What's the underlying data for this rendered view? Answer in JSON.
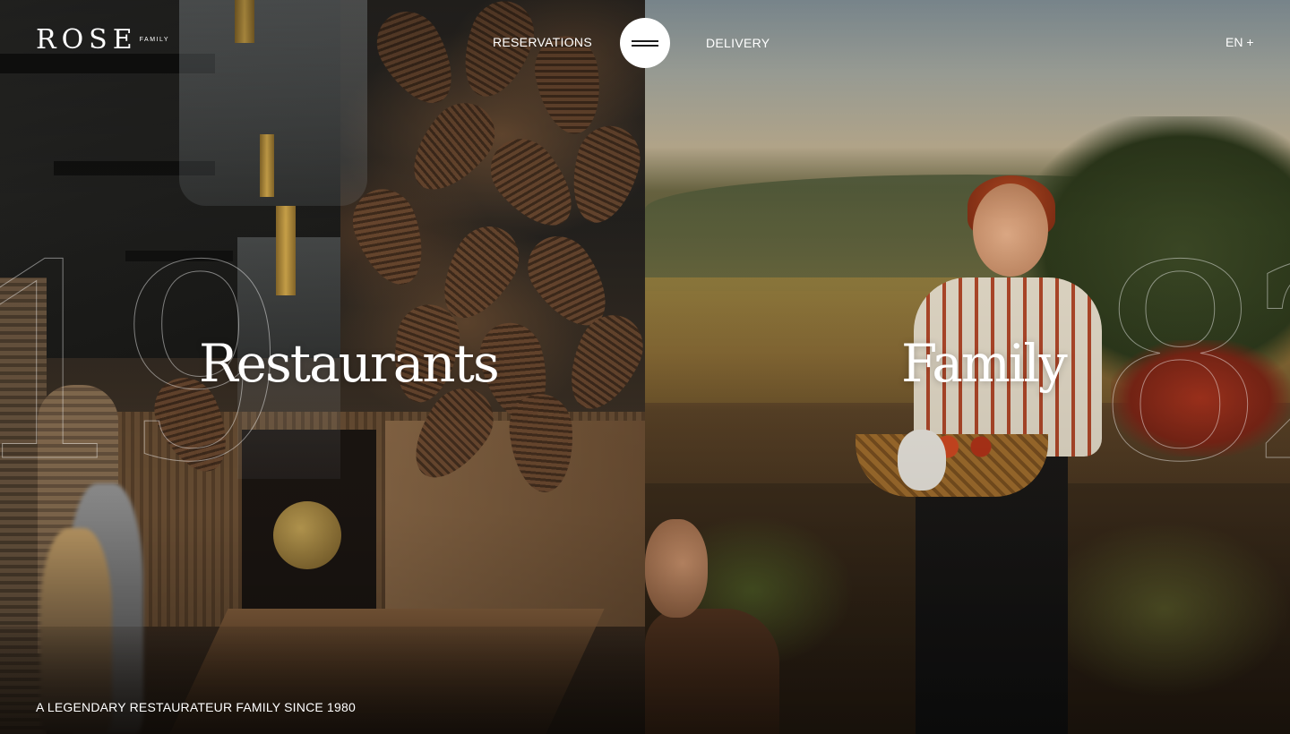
{
  "header": {
    "logo": {
      "word": "ROSE",
      "sub": "FAMILY"
    },
    "nav": {
      "reservations": "RESERVATIONS",
      "delivery": "DELIVERY"
    },
    "menu_icon": "hamburger-icon",
    "language": "EN +"
  },
  "panels": {
    "left": {
      "title": "Restaurants",
      "year_fragment": "19"
    },
    "right": {
      "title": "Family",
      "year_fragment": "82"
    }
  },
  "footer": {
    "tagline": "A LEGENDARY RESTAURATEUR FAMILY SINCE 1980"
  },
  "colors": {
    "text": "#ffffff",
    "menu_button_bg": "#ffffff"
  }
}
